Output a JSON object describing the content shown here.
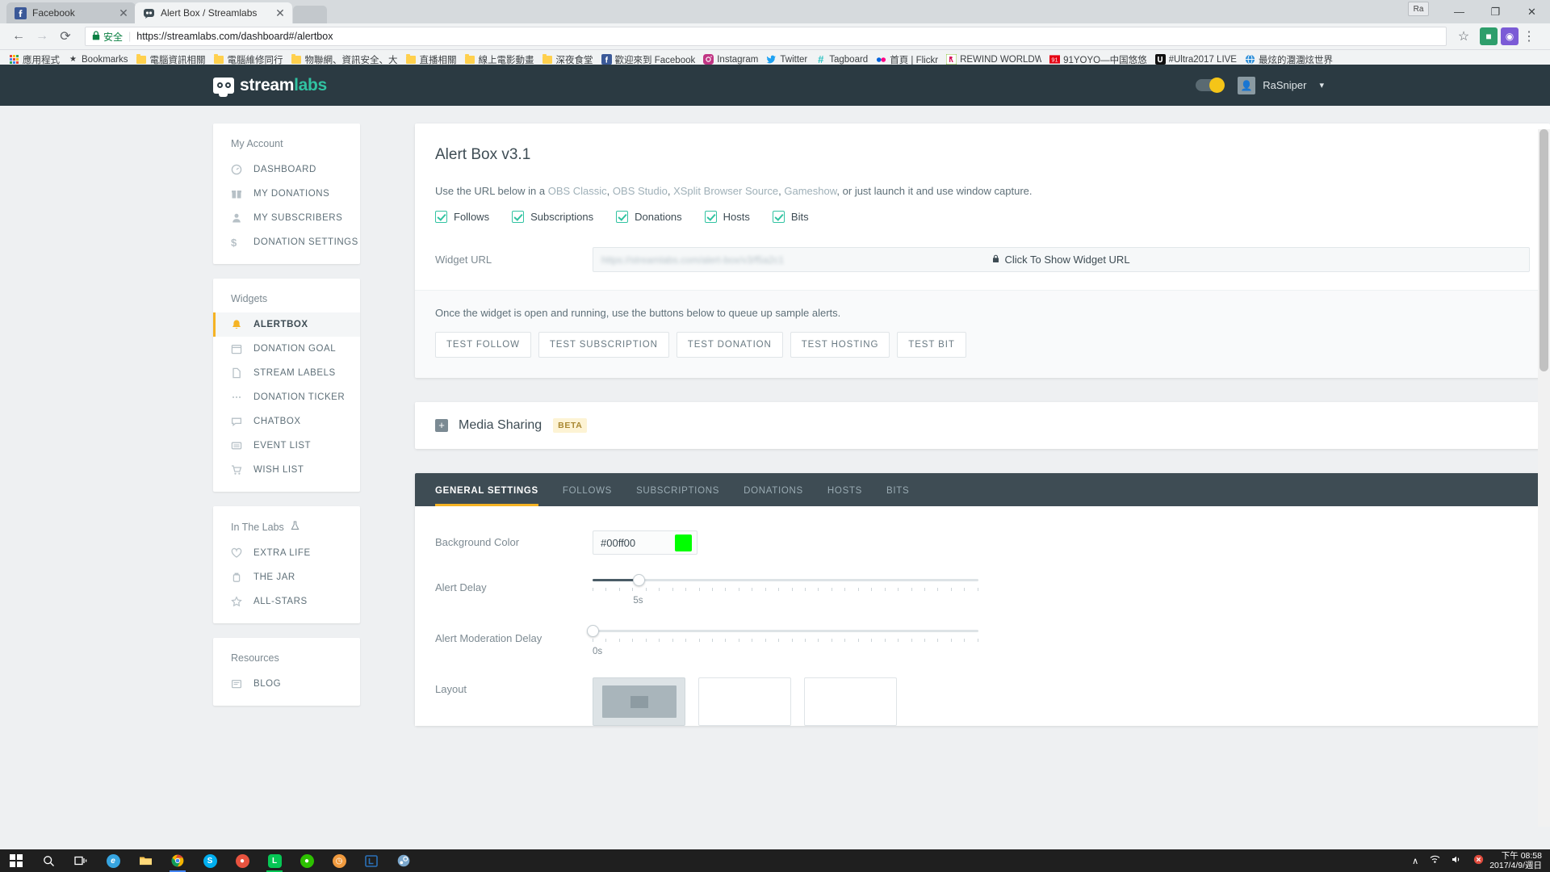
{
  "browser": {
    "tabs": [
      {
        "title": "Facebook",
        "icon": "facebook-icon",
        "active": false
      },
      {
        "title": "Alert Box / Streamlabs",
        "icon": "streamlabs-icon",
        "active": true
      }
    ],
    "close_glyph": "✕",
    "nav": {
      "back": "←",
      "forward": "→",
      "reload": "⟳",
      "star": "☆",
      "menu": "⋮"
    },
    "address": {
      "secure_label": "安全",
      "lock_icon": "lock-icon",
      "url": "https://streamlabs.com/dashboard#/alertbox"
    },
    "ime_badge": "Ra",
    "window_controls": {
      "minimize": "—",
      "maximize": "❐",
      "close": "✕"
    },
    "bookmarks": [
      {
        "label": "應用程式",
        "icon": "apps-grid-icon"
      },
      {
        "label": "Bookmarks",
        "icon": "star-icon"
      },
      {
        "label": "電腦資訊相關",
        "icon": "folder-icon"
      },
      {
        "label": "電腦維修同行",
        "icon": "folder-icon"
      },
      {
        "label": "物聯網、資訊安全、大",
        "icon": "folder-icon"
      },
      {
        "label": "直播相關",
        "icon": "folder-icon"
      },
      {
        "label": "線上電影動畫",
        "icon": "folder-icon"
      },
      {
        "label": "深夜食堂",
        "icon": "folder-icon"
      },
      {
        "label": "歡迎來到 Facebook",
        "icon": "facebook-icon"
      },
      {
        "label": "Instagram",
        "icon": "instagram-icon"
      },
      {
        "label": "Twitter",
        "icon": "twitter-icon"
      },
      {
        "label": "Tagboard",
        "icon": "tagboard-icon"
      },
      {
        "label": "首頁 | Flickr",
        "icon": "flickr-icon"
      },
      {
        "label": "REWIND WORLDWID",
        "icon": "rewind-icon"
      },
      {
        "label": "91YOYO—中国悠悠",
        "icon": "yoyo-icon"
      },
      {
        "label": "#Ultra2017 LIVE",
        "icon": "ultra-icon"
      },
      {
        "label": "最炫的潿潿炫世界",
        "icon": "globe-icon"
      }
    ]
  },
  "app": {
    "logo": {
      "stream": "stream",
      "labs": "labs",
      "icon": "streamlabs-logo-icon"
    },
    "username": "RaSniper",
    "avatar_icon": "user-avatar-icon",
    "caret_icon": "chevron-down-icon",
    "toggle_icon": "theme-toggle"
  },
  "sidebar": {
    "cards": [
      {
        "title": "My Account",
        "items": [
          {
            "label": "DASHBOARD",
            "icon": "gauge-icon",
            "active": false
          },
          {
            "label": "MY DONATIONS",
            "icon": "gift-icon",
            "active": false
          },
          {
            "label": "MY SUBSCRIBERS",
            "icon": "person-icon",
            "active": false
          },
          {
            "label": "DONATION SETTINGS",
            "icon": "dollar-icon",
            "active": false
          }
        ]
      },
      {
        "title": "Widgets",
        "items": [
          {
            "label": "ALERTBOX",
            "icon": "bell-icon",
            "active": true
          },
          {
            "label": "DONATION GOAL",
            "icon": "calendar-icon",
            "active": false
          },
          {
            "label": "STREAM LABELS",
            "icon": "document-icon",
            "active": false
          },
          {
            "label": "DONATION TICKER",
            "icon": "ticker-icon",
            "active": false
          },
          {
            "label": "CHATBOX",
            "icon": "chat-icon",
            "active": false
          },
          {
            "label": "EVENT LIST",
            "icon": "list-icon",
            "active": false
          },
          {
            "label": "WISH LIST",
            "icon": "cart-icon",
            "active": false
          }
        ]
      },
      {
        "title": "In The Labs",
        "title_icon": "flask-icon",
        "items": [
          {
            "label": "EXTRA LIFE",
            "icon": "heart-icon",
            "active": false
          },
          {
            "label": "THE JAR",
            "icon": "jar-icon",
            "active": false
          },
          {
            "label": "ALL-STARS",
            "icon": "star-icon",
            "active": false
          }
        ]
      },
      {
        "title": "Resources",
        "items": [
          {
            "label": "BLOG",
            "icon": "blog-icon",
            "active": false
          }
        ]
      }
    ]
  },
  "alertbox": {
    "heading": "Alert Box v3.1",
    "description_prefix": "Use the URL below in a ",
    "description_links": [
      "OBS Classic",
      "OBS Studio",
      "XSplit Browser Source",
      "Gameshow"
    ],
    "description_suffix": ", or just launch it and use window capture.",
    "description_full": "Use the URL below in a OBS Classic, OBS Studio, XSplit Browser Source, Gameshow, or just launch it and use window capture.",
    "checkboxes": [
      {
        "label": "Follows",
        "checked": true
      },
      {
        "label": "Subscriptions",
        "checked": true
      },
      {
        "label": "Donations",
        "checked": true
      },
      {
        "label": "Hosts",
        "checked": true
      },
      {
        "label": "Bits",
        "checked": true
      }
    ],
    "widget_url_label": "Widget URL",
    "widget_url_hidden_value": "https://streamlabs.com/alert-box/v3/f5a2c1",
    "widget_url_overlay": "Click To Show Widget URL",
    "widget_url_lock_icon": "lock-icon",
    "footer_text": "Once the widget is open and running, use the buttons below to queue up sample alerts.",
    "test_buttons": [
      "TEST FOLLOW",
      "TEST SUBSCRIPTION",
      "TEST DONATION",
      "TEST HOSTING",
      "TEST BIT"
    ]
  },
  "media_sharing": {
    "expand_icon": "plus-box-icon",
    "title": "Media Sharing",
    "badge": "BETA"
  },
  "settings": {
    "tabs": [
      {
        "label": "GENERAL SETTINGS",
        "active": true
      },
      {
        "label": "FOLLOWS",
        "active": false
      },
      {
        "label": "SUBSCRIPTIONS",
        "active": false
      },
      {
        "label": "DONATIONS",
        "active": false
      },
      {
        "label": "HOSTS",
        "active": false
      },
      {
        "label": "BITS",
        "active": false
      }
    ],
    "background_color": {
      "label": "Background Color",
      "value": "#00ff00",
      "swatch": "#00ff00"
    },
    "alert_delay": {
      "label": "Alert Delay",
      "value_text": "5s",
      "percent": 12
    },
    "alert_moderation_delay": {
      "label": "Alert Moderation Delay",
      "value_text": "0s",
      "percent": 0
    },
    "layout": {
      "label": "Layout",
      "options": [
        {
          "name": "above",
          "selected": true
        },
        {
          "name": "banner",
          "selected": false
        },
        {
          "name": "side",
          "selected": false
        }
      ]
    }
  },
  "taskbar": {
    "start_icon": "windows-start-icon",
    "items": [
      {
        "name": "search-icon",
        "glyph": "⌕",
        "color": "#ffffff"
      },
      {
        "name": "task-view-icon",
        "glyph": "▭",
        "color": "#ffffff"
      },
      {
        "name": "edge-icon",
        "glyph": "e",
        "color": "#36a4e0"
      },
      {
        "name": "file-explorer-icon",
        "glyph": "☰",
        "color": "#f7c04a"
      },
      {
        "name": "chrome-icon",
        "glyph": "◉",
        "color": "#4285f4"
      },
      {
        "name": "skype-icon",
        "glyph": "S",
        "color": "#00aff0"
      },
      {
        "name": "recorder-icon",
        "glyph": "◉",
        "color": "#e8533f"
      },
      {
        "name": "line-icon",
        "glyph": "L",
        "color": "#06c755"
      },
      {
        "name": "wechat-icon",
        "glyph": "◕",
        "color": "#2dc100"
      },
      {
        "name": "clock-app-icon",
        "glyph": "◴",
        "color": "#f09a3e"
      },
      {
        "name": "libreoffice-icon",
        "glyph": "L",
        "color": "#2b71b8"
      },
      {
        "name": "steam-icon",
        "glyph": "⚙",
        "color": "#7ba7cc"
      }
    ],
    "tray": {
      "chevron": "∧",
      "network_icon": "network-icon",
      "volume_icon": "volume-icon",
      "alert_icon": "action-center-icon",
      "time": "下午 08:58",
      "date": "2017/4/9/週日"
    }
  }
}
